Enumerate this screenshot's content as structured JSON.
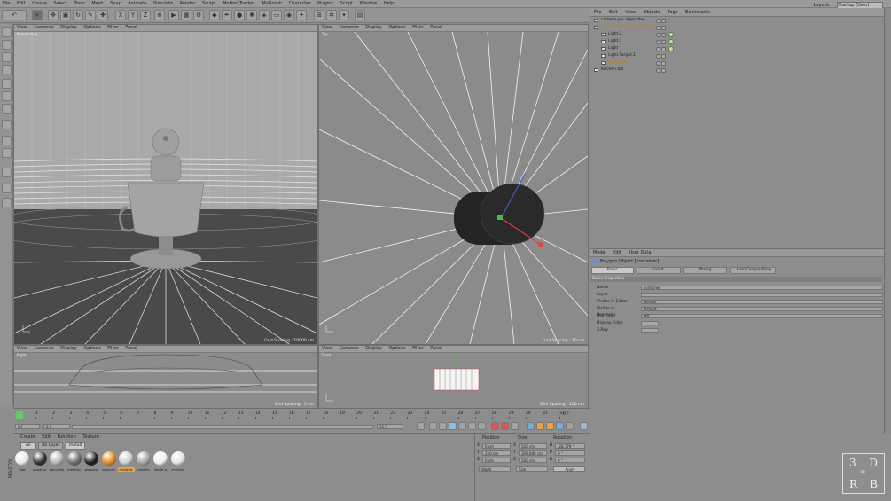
{
  "menu": {
    "items": [
      "File",
      "Edit",
      "Create",
      "Select",
      "Tools",
      "Mesh",
      "Snap",
      "Animate",
      "Simulate",
      "Render",
      "Sculpt",
      "Motion Tracker",
      "MoGraph",
      "Character",
      "Plugins",
      "Script",
      "Window",
      "Help"
    ],
    "layout_label": "Layout:",
    "layout_value": "Startup (User)"
  },
  "toolbar": {
    "undo_icon": "undo-icon",
    "axis_x": "X",
    "axis_y": "Y",
    "axis_z": "Z"
  },
  "viewport_menu": [
    "View",
    "Cameras",
    "Display",
    "Options",
    "Filter",
    "Panel"
  ],
  "viewports": {
    "perspective": {
      "label": "Perspective",
      "grid": "Grid Spacing : 10000 cm"
    },
    "top": {
      "label": "Top",
      "grid": "Grid Spacing : 10 cm"
    },
    "right": {
      "label": "Right",
      "grid": "Grid Spacing : 5 cm"
    },
    "front": {
      "label": "Front",
      "grid": "Grid Spacing : 100 cm"
    }
  },
  "object_manager": {
    "menu": [
      "File",
      "Edit",
      "View",
      "Objects",
      "Tags",
      "Bookmarks"
    ],
    "rows": [
      {
        "name": "camera per object/ter",
        "indent": 0,
        "color": "#222222"
      },
      {
        "name": "environment per object/ter",
        "indent": 0,
        "color": "#c47a12"
      },
      {
        "name": "Light.2",
        "indent": 1,
        "color": "#222222"
      },
      {
        "name": "Light.1",
        "indent": 1,
        "color": "#222222"
      },
      {
        "name": "Light",
        "indent": 1,
        "color": "#222222"
      },
      {
        "name": "Light.Target.1",
        "indent": 1,
        "color": "#222222"
      },
      {
        "name": "container",
        "indent": 1,
        "color": "#c47a12"
      },
      {
        "name": "Kitchen aid",
        "indent": 0,
        "color": "#222222"
      }
    ]
  },
  "attributes": {
    "menu": [
      "Mode",
      "Edit",
      "User Data"
    ],
    "title": "Polygon Object [container]",
    "tabs": [
      "Basic",
      "Coord.",
      "Phong",
      "Hair/Compositing"
    ],
    "section": "Basic Properties",
    "props": [
      {
        "label": "Name",
        "value": "container"
      },
      {
        "label": "Layer",
        "value": ""
      },
      {
        "label": "Visible in Editor",
        "value": "Default"
      },
      {
        "label": "Visible in Renderer",
        "value": "Default"
      },
      {
        "label": "Use Color",
        "value": "Off"
      },
      {
        "label": "Display Color",
        "value": ""
      },
      {
        "label": "X-Ray",
        "value": ""
      }
    ]
  },
  "timeline": {
    "ticks": [
      "0",
      "1",
      "2",
      "3",
      "4",
      "5",
      "6",
      "7",
      "8",
      "9",
      "10",
      "11",
      "12",
      "13",
      "14",
      "15",
      "16",
      "17",
      "18",
      "19",
      "20",
      "21",
      "22",
      "23",
      "24",
      "25",
      "26",
      "27",
      "28",
      "29",
      "30",
      "31",
      "32"
    ],
    "current_frame": "0 F",
    "start": "0 F",
    "min": "0 F",
    "end": "32 F",
    "end_label": "0 F"
  },
  "materials": {
    "menu": [
      "Create",
      "Edit",
      "Function",
      "Texture"
    ],
    "filters": [
      "All",
      "No Layer",
      "metall"
    ],
    "items": [
      {
        "name": "Mat",
        "color": "#e8e8e8"
      },
      {
        "name": "plastica",
        "color": "#2e2e2e"
      },
      {
        "name": "concrete",
        "color": "#b5b5b5"
      },
      {
        "name": "metallic",
        "color": "#6c6c6c"
      },
      {
        "name": "plastica",
        "color": "#1c1c1c"
      },
      {
        "name": "arancio",
        "color": "#e38a18"
      },
      {
        "name": "metalliz",
        "color": "#d0d0d0"
      },
      {
        "name": "metallic",
        "color": "#a0a0a0"
      },
      {
        "name": "white p",
        "color": "#f0f0f0"
      },
      {
        "name": "chrome",
        "color": "#e3e3e3"
      }
    ]
  },
  "coordinates": {
    "headers": [
      "Position",
      "Size",
      "Rotation"
    ],
    "rows": [
      {
        "axis": "X",
        "pos": "0 cm",
        "sax": "X",
        "size": "500 cm",
        "rax": "H",
        "rot": "-28.779 °"
      },
      {
        "axis": "Y",
        "pos": "250 cm",
        "sax": "Y",
        "size": "309.080 cm",
        "rax": "P",
        "rot": "0 °"
      },
      {
        "axis": "Z",
        "pos": "0 cm",
        "sax": "Z",
        "size": "500 cm",
        "rax": "B",
        "rot": "0 °"
      }
    ],
    "space": "World",
    "mode": "Size",
    "apply": "Apply"
  },
  "logo": {
    "tl": "3",
    "tr": "D",
    "bl": "R",
    "br": "B",
    "mid": "m"
  }
}
